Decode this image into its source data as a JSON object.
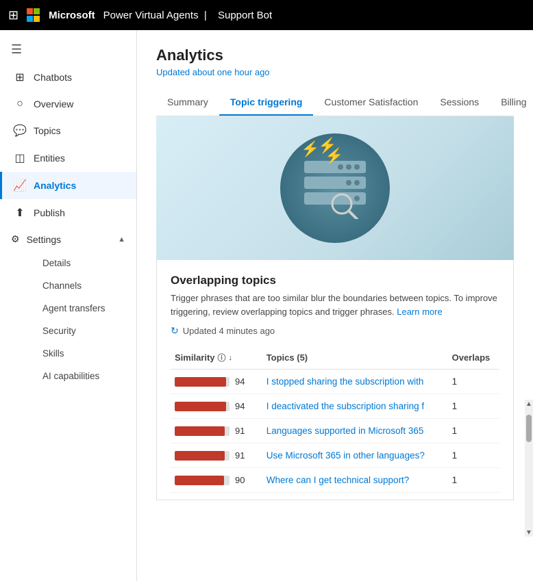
{
  "topbar": {
    "grid_icon": "⊞",
    "brand": "Microsoft",
    "divider": "|",
    "app_name": "Power Virtual Agents",
    "bot_name": "Support Bot"
  },
  "sidebar": {
    "hamburger": "☰",
    "items": [
      {
        "id": "chatbots",
        "label": "Chatbots",
        "icon": "⊞"
      },
      {
        "id": "overview",
        "label": "Overview",
        "icon": "⊙"
      },
      {
        "id": "topics",
        "label": "Topics",
        "icon": "💬"
      },
      {
        "id": "entities",
        "label": "Entities",
        "icon": "⊞"
      },
      {
        "id": "analytics",
        "label": "Analytics",
        "icon": "📈",
        "active": true
      },
      {
        "id": "publish",
        "label": "Publish",
        "icon": "⬆"
      },
      {
        "id": "settings",
        "label": "Settings",
        "icon": "⚙"
      }
    ],
    "settings_sub": [
      {
        "id": "details",
        "label": "Details"
      },
      {
        "id": "channels",
        "label": "Channels"
      },
      {
        "id": "agent-transfers",
        "label": "Agent transfers"
      },
      {
        "id": "security",
        "label": "Security"
      },
      {
        "id": "skills",
        "label": "Skills"
      },
      {
        "id": "ai-capabilities",
        "label": "AI capabilities"
      }
    ]
  },
  "page": {
    "title": "Analytics",
    "subtitle": "Updated about one hour ago"
  },
  "tabs": [
    {
      "id": "summary",
      "label": "Summary"
    },
    {
      "id": "topic-triggering",
      "label": "Topic triggering",
      "active": true
    },
    {
      "id": "customer-satisfaction",
      "label": "Customer Satisfaction"
    },
    {
      "id": "sessions",
      "label": "Sessions"
    },
    {
      "id": "billing",
      "label": "Billing"
    }
  ],
  "section": {
    "title": "Overlapping topics",
    "description": "Trigger phrases that are too similar blur the boundaries between topics. To improve triggering, review overlapping topics and trigger phrases.",
    "learn_more_label": "Learn more",
    "updated_label": "Updated 4 minutes ago"
  },
  "table": {
    "col_similarity": "Similarity",
    "col_topics": "Topics (5)",
    "col_overlaps": "Overlaps",
    "rows": [
      {
        "similarity": 94,
        "bar_pct": 94,
        "topic": "I stopped sharing the subscription with",
        "overlaps": 1
      },
      {
        "similarity": 94,
        "bar_pct": 94,
        "topic": "I deactivated the subscription sharing f",
        "overlaps": 1
      },
      {
        "similarity": 91,
        "bar_pct": 91,
        "topic": "Languages supported in Microsoft 365",
        "overlaps": 1
      },
      {
        "similarity": 91,
        "bar_pct": 91,
        "topic": "Use Microsoft 365 in other languages?",
        "overlaps": 1
      },
      {
        "similarity": 90,
        "bar_pct": 90,
        "topic": "Where can I get technical support?",
        "overlaps": 1
      }
    ]
  }
}
